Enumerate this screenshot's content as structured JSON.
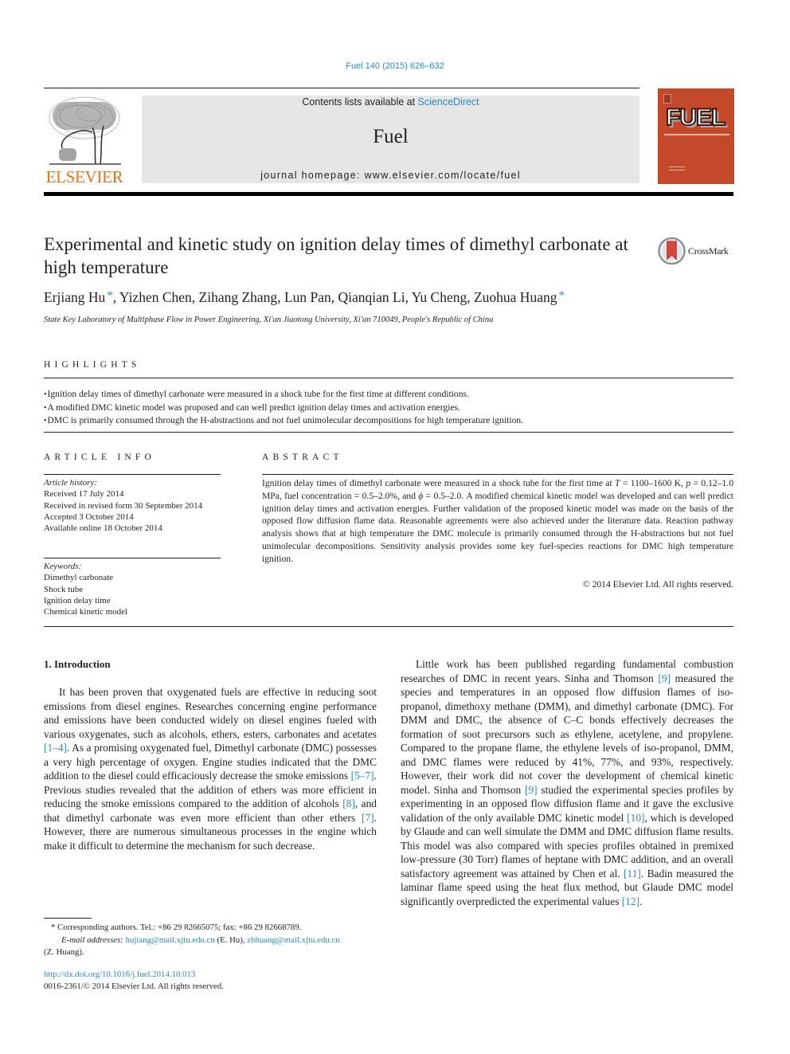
{
  "journal_reference": "Fuel 140 (2015) 626–632",
  "masthead": {
    "publisher_wordmark": "ELSEVIER",
    "contents_prefix": "Contents lists available at ",
    "contents_link": "ScienceDirect",
    "journal_name": "Fuel",
    "homepage": "journal homepage: www.elsevier.com/locate/fuel",
    "cover_title": "FUEL",
    "cover_color": "#c4492a"
  },
  "article": {
    "title": "Experimental and kinetic study on ignition delay times of dimethyl carbonate at high temperature",
    "crossmark_label": "CrossMark",
    "authors": [
      {
        "name": "Erjiang Hu",
        "corresponding": true,
        "sep": ", "
      },
      {
        "name": "Yizhen Chen",
        "corresponding": false,
        "sep": ", "
      },
      {
        "name": "Zihang Zhang",
        "corresponding": false,
        "sep": ", "
      },
      {
        "name": "Lun Pan",
        "corresponding": false,
        "sep": ", "
      },
      {
        "name": "Qianqian Li",
        "corresponding": false,
        "sep": ", "
      },
      {
        "name": "Yu Cheng",
        "corresponding": false,
        "sep": ", "
      },
      {
        "name": "Zuohua Huang",
        "corresponding": true,
        "sep": ""
      }
    ],
    "corresponding_mark": "*",
    "affiliation": "State Key Laboratory of Multiphase Flow in Power Engineering, Xi'an Jiaotong University, Xi'an 710049, People's Republic of China"
  },
  "highlights": {
    "heading": "HIGHLIGHTS",
    "items": [
      "Ignition delay times of dimethyl carbonate were measured in a shock tube for the first time at different conditions.",
      "A modified DMC kinetic model was proposed and can well predict ignition delay times and activation energies.",
      "DMC is primarily consumed through the H-abstractions and not fuel unimolecular decompositions for high temperature ignition."
    ]
  },
  "article_info": {
    "heading": "ARTICLE INFO",
    "history_label": "Article history:",
    "history": [
      "Received 17 July 2014",
      "Received in revised form 30 September 2014",
      "Accepted 3 October 2014",
      "Available online 18 October 2014"
    ],
    "keywords_label": "Keywords:",
    "keywords": [
      "Dimethyl carbonate",
      "Shock tube",
      "Ignition delay time",
      "Chemical kinetic model"
    ]
  },
  "abstract": {
    "heading": "ABSTRACT",
    "text_1": "Ignition delay times of dimethyl carbonate were measured in a shock tube for the first time at ",
    "var_T": "T",
    "text_2": " = 1100–1600 K, ",
    "var_p": "p",
    "text_3": " = 0.12–1.0 MPa, fuel concentration = 0.5–2.0%, and ",
    "var_phi": "ϕ",
    "text_4": " = 0.5–2.0. A modified chemical kinetic model was developed and can well predict ignition delay times and activation energies. Further validation of the proposed kinetic model was made on the basis of the opposed flow diffusion flame data. Reasonable agreements were also achieved under the literature data. Reaction pathway analysis shows that at high temperature the DMC molecule is primarily consumed through the H-abstractions but not fuel unimolecular decompositions. Sensitivity analysis provides some key fuel-species reactions for DMC high temperature ignition.",
    "copyright": "© 2014 Elsevier Ltd. All rights reserved."
  },
  "introduction": {
    "heading": "1. Introduction",
    "p1": [
      {
        "t": "It has been proven that oxygenated fuels are effective in reducing soot emissions from diesel engines. Researches concerning engine performance and emissions have been conducted widely on diesel engines fueled with various oxygenates, such as alcohols, ethers, esters, carbonates and acetates "
      },
      {
        "c": "[1–4]"
      },
      {
        "t": ". As a promising oxygenated fuel, Dimethyl carbonate (DMC) possesses a very high percentage of oxygen. Engine studies indicated that the DMC addition to the diesel could efficaciously decrease the smoke emissions "
      },
      {
        "c": "[5–7]"
      },
      {
        "t": ". Previous studies revealed that the addition of ethers was more efficient in reducing the smoke emissions compared to the addition of alcohols "
      },
      {
        "c": "[8]"
      },
      {
        "t": ", and that dimethyl carbonate was even more efficient than other ethers "
      },
      {
        "c": "[7]"
      },
      {
        "t": ". However, there are numerous simultaneous processes in the engine which make it difficult to determine the mechanism for such decrease."
      }
    ],
    "p2": [
      {
        "t": "Little work has been published regarding fundamental combustion researches of DMC in recent years. Sinha and Thomson "
      },
      {
        "c": "[9]"
      },
      {
        "t": " measured the species and temperatures in an opposed flow diffusion flames of iso-propanol, dimethoxy methane (DMM), and dimethyl carbonate (DMC). For DMM and DMC, the absence of C–C bonds effectively decreases the formation of soot precursors such as ethylene, acetylene, and propylene. Compared to the propane flame, the ethylene levels of iso-propanol, DMM, and DMC flames were reduced by 41%, 77%, and 93%, respectively. However, their work did not cover the development of chemical kinetic model. Sinha and Thomson "
      },
      {
        "c": "[9]"
      },
      {
        "t": " studied the experimental species profiles by experimenting in an opposed flow diffusion flame and it gave the exclusive validation of the only available DMC kinetic model "
      },
      {
        "c": "[10]"
      },
      {
        "t": ", which is developed by Glaude and can well simulate the DMM and DMC diffusion flame results. This model was also compared with species profiles obtained in premixed low-pressure (30 Torr) flames of heptane with DMC addition, and an overall satisfactory agreement was attained by Chen et al. "
      },
      {
        "c": "[11]"
      },
      {
        "t": ". Badin measured the laminar flame speed using the heat flux method, but Glaude DMC model significantly overpredicted the experimental values "
      },
      {
        "c": "[12]"
      },
      {
        "t": "."
      }
    ]
  },
  "footnote": {
    "mark": "*",
    "corresponding": "Corresponding authors. Tel.: +86 29 82665075; fax: +86 29 82668789.",
    "email_label": "E-mail addresses:",
    "email_1": "hujiang@mail.xjtu.edu.cn",
    "email_1_who": " (E. Hu), ",
    "email_2": "zhhuang@mail.xjtu.edu.cn",
    "email_2_who": "(Z. Huang)."
  },
  "doi": {
    "link": "http://dx.doi.org/10.1016/j.fuel.2014.10.013",
    "issn_line": "0016-2361/© 2014 Elsevier Ltd. All rights reserved."
  }
}
